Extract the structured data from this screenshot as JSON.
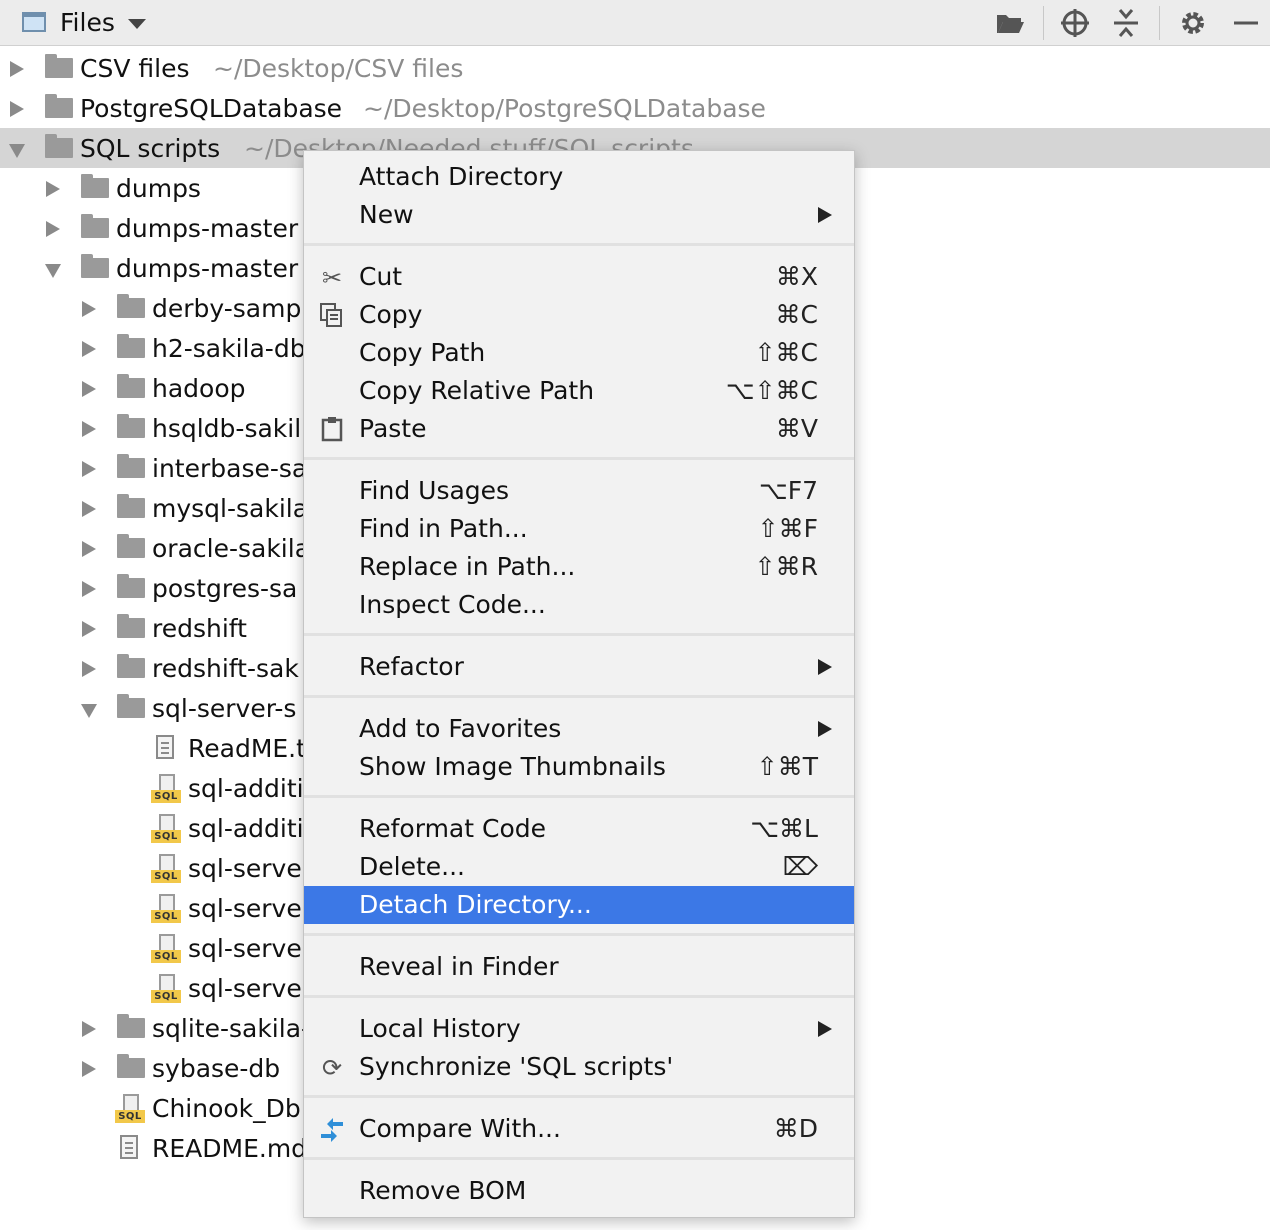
{
  "toolbar": {
    "title": "Files"
  },
  "tree": [
    {
      "name": "CSV files",
      "path": "~/Desktop/CSV files"
    },
    {
      "name": "PostgreSQLDatabase",
      "path": "~/Desktop/PostgreSQLDatabase"
    },
    {
      "name": "SQL scripts",
      "path": "~/Desktop/Needed stuff/SQL scripts"
    },
    {
      "name": "dumps"
    },
    {
      "name": "dumps-master"
    },
    {
      "name": "dumps-master"
    },
    {
      "name": "derby-sampl"
    },
    {
      "name": "h2-sakila-db"
    },
    {
      "name": "hadoop"
    },
    {
      "name": "hsqldb-sakil"
    },
    {
      "name": "interbase-sa"
    },
    {
      "name": "mysql-sakila"
    },
    {
      "name": "oracle-sakila"
    },
    {
      "name": "postgres-sa"
    },
    {
      "name": "redshift"
    },
    {
      "name": "redshift-sak"
    },
    {
      "name": "sql-server-s"
    },
    {
      "name": "ReadME.t"
    },
    {
      "name": "sql-additi"
    },
    {
      "name": "sql-additi"
    },
    {
      "name": "sql-serve"
    },
    {
      "name": "sql-serve"
    },
    {
      "name": "sql-serve"
    },
    {
      "name": "sql-serve"
    },
    {
      "name": "sqlite-sakila-"
    },
    {
      "name": "sybase-db"
    },
    {
      "name": "Chinook_Db"
    },
    {
      "name": "README.md"
    }
  ],
  "menu": {
    "attach_directory": "Attach Directory",
    "new": "New",
    "cut": "Cut",
    "cut_sc": "⌘X",
    "copy": "Copy",
    "copy_sc": "⌘C",
    "copy_path": "Copy Path",
    "copy_path_sc": "⇧⌘C",
    "copy_relative_path": "Copy Relative Path",
    "copy_relative_path_sc": "⌥⇧⌘C",
    "paste": "Paste",
    "paste_sc": "⌘V",
    "find_usages": "Find Usages",
    "find_usages_sc": "⌥F7",
    "find_in_path": "Find in Path...",
    "find_in_path_sc": "⇧⌘F",
    "replace_in_path": "Replace in Path...",
    "replace_in_path_sc": "⇧⌘R",
    "inspect_code": "Inspect Code...",
    "refactor": "Refactor",
    "add_to_favorites": "Add to Favorites",
    "show_image_thumbnails": "Show Image Thumbnails",
    "show_image_thumbnails_sc": "⇧⌘T",
    "reformat_code": "Reformat Code",
    "reformat_code_sc": "⌥⌘L",
    "delete": "Delete...",
    "delete_sc": "⌦",
    "detach_directory": "Detach Directory...",
    "reveal_in_finder": "Reveal in Finder",
    "local_history": "Local History",
    "synchronize": "Synchronize 'SQL scripts'",
    "compare_with": "Compare With...",
    "compare_with_sc": "⌘D",
    "remove_bom": "Remove BOM"
  },
  "colors": {
    "highlight": "#3c78e6",
    "selected_row": "#d5d5d5",
    "sql_badge": "#f2c84a"
  }
}
